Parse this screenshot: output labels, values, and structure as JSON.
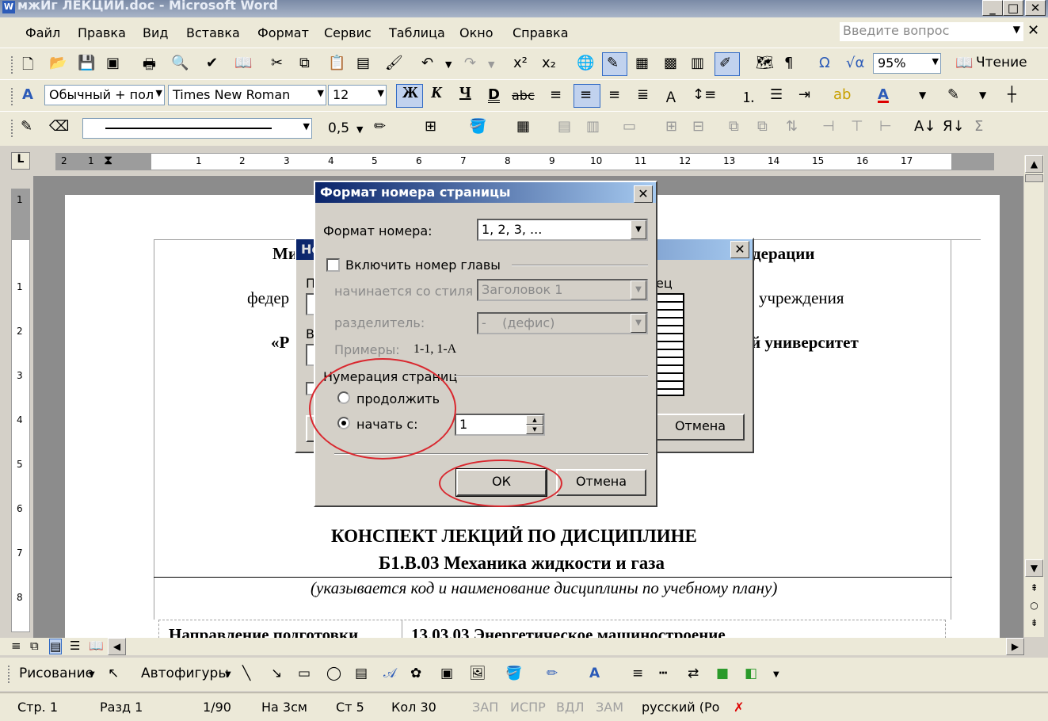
{
  "window": {
    "title": "мжИг ЛЕКЦИИ.doc - Microsoft Word",
    "app_icon": "W"
  },
  "menu": {
    "items": [
      "Файл",
      "Правка",
      "Вид",
      "Вставка",
      "Формат",
      "Сервис",
      "Таблица",
      "Окно",
      "Справка"
    ],
    "ask_placeholder": "Введите вопрос"
  },
  "toolbar1": {
    "zoom": "95%",
    "reading": "Чтение"
  },
  "toolbar2": {
    "style": "Обычный + пол",
    "font": "Times New Roman",
    "size": "12",
    "bold": "Ж",
    "italic": "К",
    "underline": "Ч",
    "strike": "abc"
  },
  "toolbar3": {
    "line_weight": "0,5"
  },
  "ruler": {
    "ticks": [
      "2",
      "1",
      "1",
      "2",
      "3",
      "4",
      "5",
      "6",
      "7",
      "8",
      "9",
      "10",
      "11",
      "12",
      "13",
      "14",
      "15",
      "16",
      "17"
    ]
  },
  "vruler": {
    "ticks": [
      "1",
      "1",
      "2",
      "3",
      "4",
      "5",
      "6",
      "7",
      "8"
    ]
  },
  "document": {
    "line1_left": "Ми",
    "line1_right": "дерации",
    "line2_left": "федер",
    "line2_right": "учреждения",
    "line3_left": "«Р",
    "line3_right": "й университет",
    "heading1": "КОНСПЕКТ ЛЕКЦИЙ ПО ДИСЦИПЛИНЕ",
    "heading2": "Б1.В.03 Механика жидкости и газа",
    "note": "(указывается код и наименование дисциплины по учебному плану)",
    "table_c1": "Направление подготовки",
    "table_c2": "13.03.03 Энергетическое машиностроение"
  },
  "back_dialog": {
    "title_fragment": "Но",
    "position_fragment": "П",
    "align_fragment": "В",
    "preview_label": "ец",
    "cancel": "Отмена"
  },
  "dialog": {
    "title": "Формат номера страницы",
    "format_label": "Формат номера:",
    "format_value": "1, 2, 3, ...",
    "include_chapter": "Включить номер главы",
    "starts_with_label": "начинается со стиля",
    "starts_with_value": "Заголовок 1",
    "separator_label": "разделитель:",
    "separator_value": "-    (дефис)",
    "examples_label": "Примеры:",
    "examples_value": "1-1, 1-А",
    "numbering_group": "Нумерация страниц",
    "continue": "продолжить",
    "start_at": "начать с:",
    "start_value": "1",
    "ok": "ОК",
    "cancel": "Отмена",
    "selected_option": "начать с:"
  },
  "drawbar": {
    "drawing": "Рисование",
    "autoshapes": "Автофигуры"
  },
  "status": {
    "page": "Стр. 1",
    "section": "Разд 1",
    "pages": "1/90",
    "at": "На 3см",
    "line": "Ст 5",
    "col": "Кол 30",
    "rec": "ЗАП",
    "trk": "ИСПР",
    "ext": "ВДЛ",
    "ovr": "ЗАМ",
    "lang": "русский (Ро"
  },
  "colors": {
    "accent_ring": "#d9282f",
    "dialog_title": "#0a246a"
  }
}
